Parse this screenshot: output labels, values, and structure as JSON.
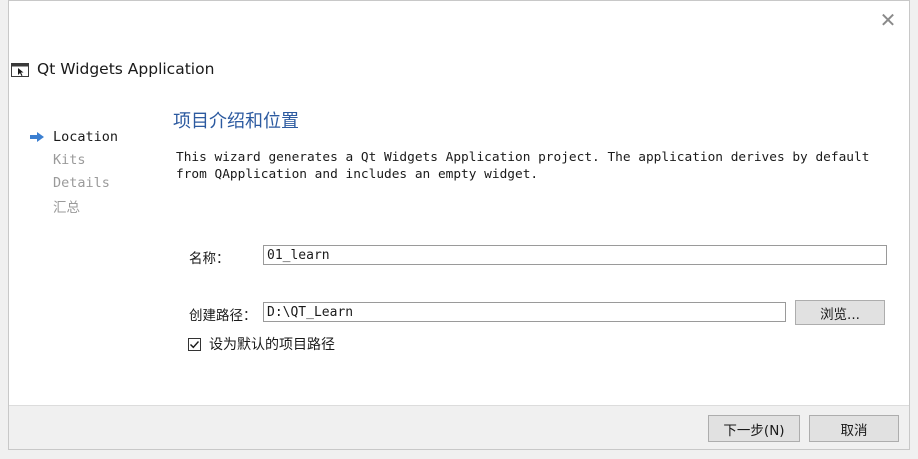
{
  "window": {
    "close_label": "✕"
  },
  "header": {
    "app_title": "Qt Widgets Application",
    "icon": "qt-app-window-icon"
  },
  "steps": [
    {
      "label": "Location",
      "active": true
    },
    {
      "label": "Kits",
      "active": false
    },
    {
      "label": "Details",
      "active": false
    },
    {
      "label": "汇总",
      "active": false
    }
  ],
  "page": {
    "title": "项目介绍和位置",
    "description": "This wizard generates a Qt Widgets Application project. The application derives by default\nfrom QApplication and includes an empty widget."
  },
  "form": {
    "name_label": "名称：",
    "name_value": "01_learn",
    "path_label": "创建路径：",
    "path_value": "D:\\QT_Learn",
    "browse_label": "浏览...",
    "default_path_label": "设为默认的项目路径",
    "default_path_checked": true
  },
  "footer": {
    "next_label": "下一步(N)",
    "cancel_label": "取消"
  },
  "colors": {
    "accent_title": "#2c5aa0",
    "arrow": "#3b7fd1",
    "inactive_step": "#9a9a9a"
  }
}
